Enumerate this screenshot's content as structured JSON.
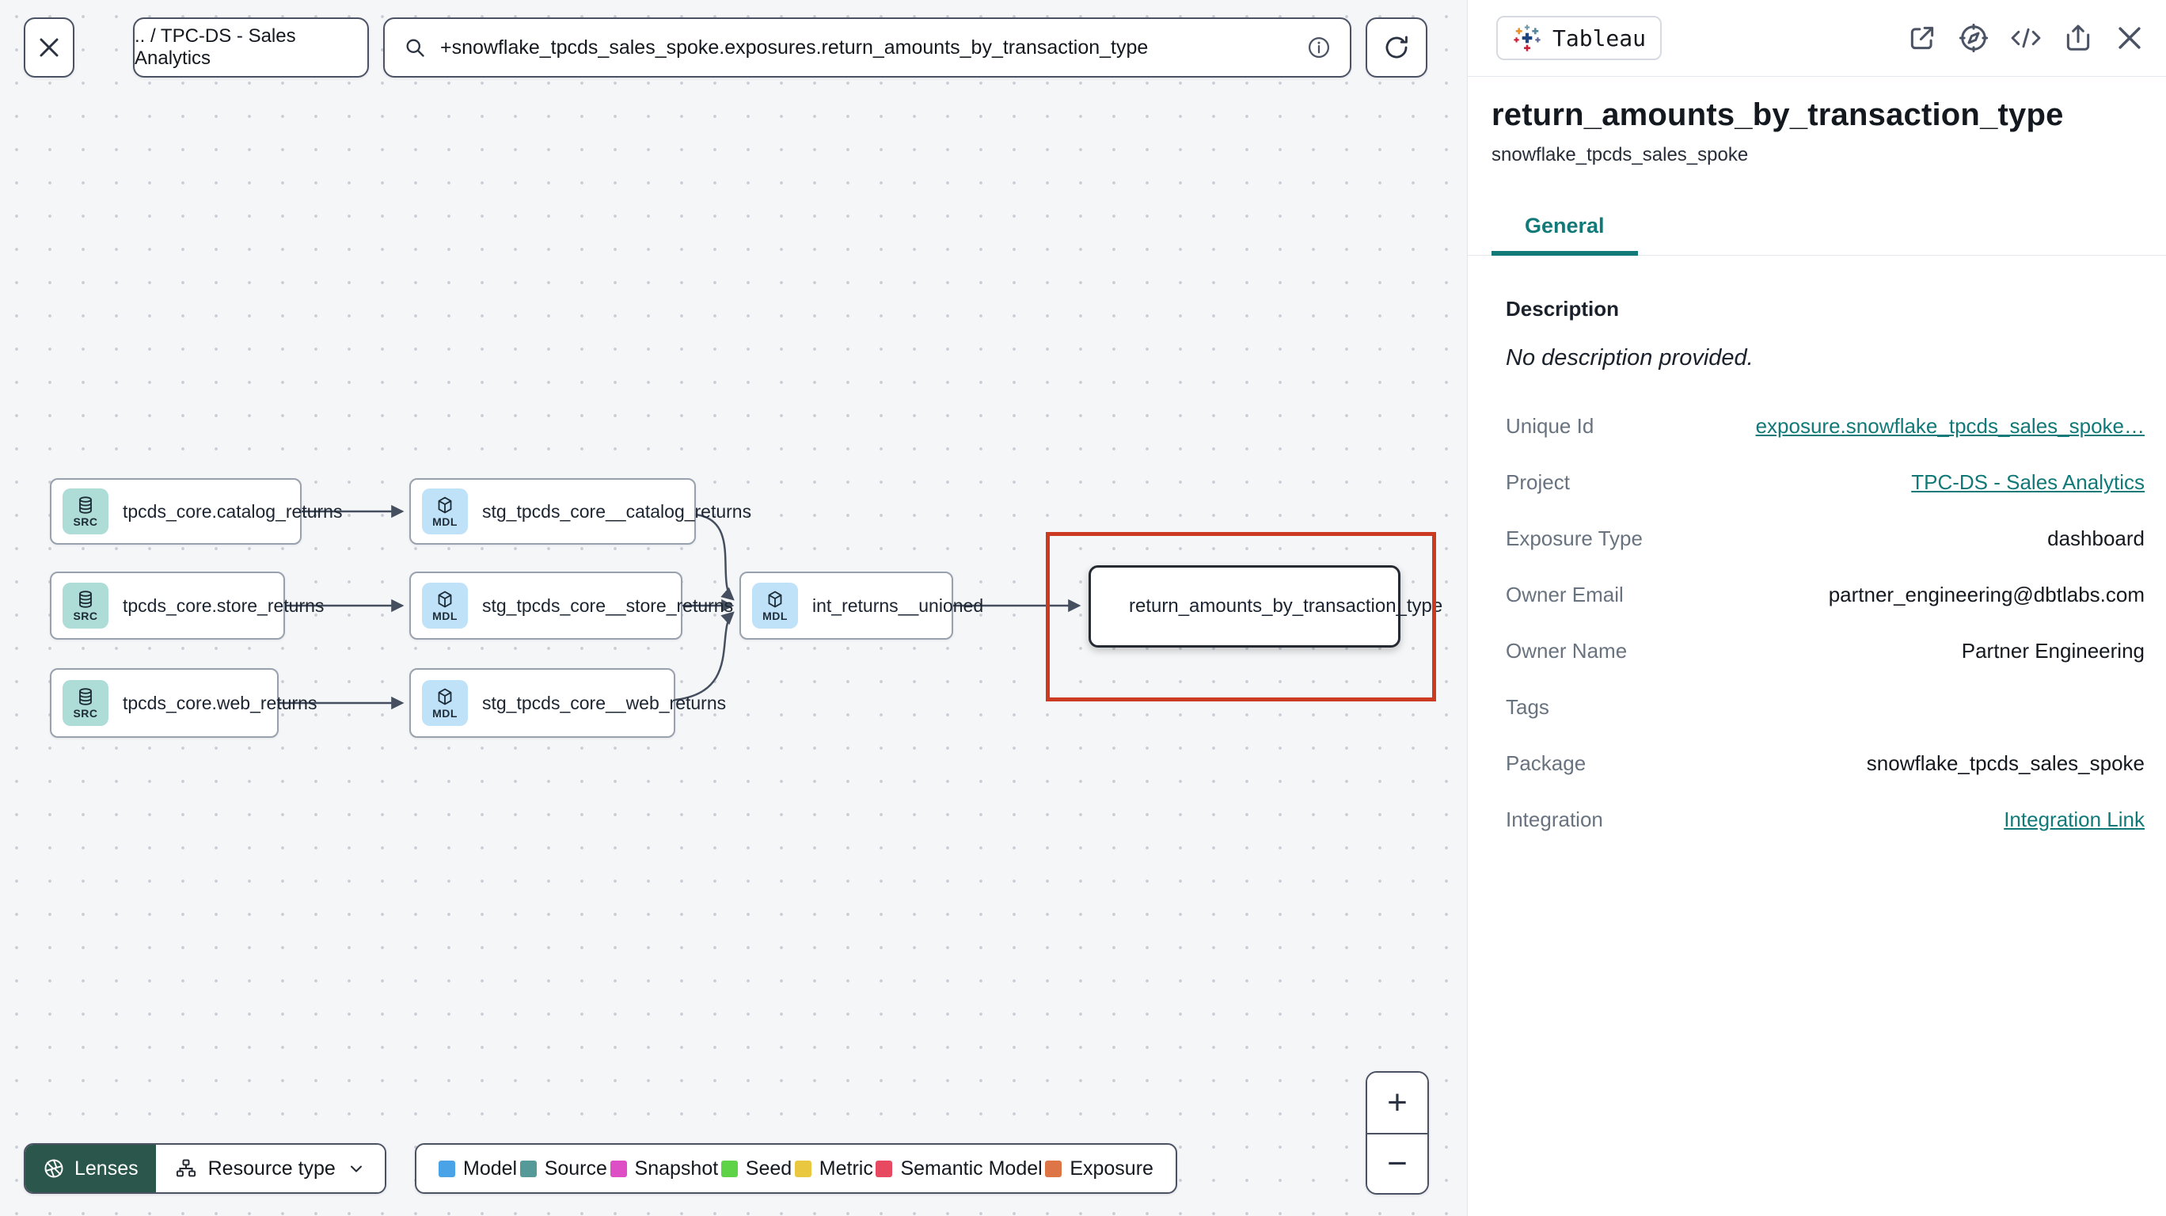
{
  "topbar": {
    "breadcrumb": ".. / TPC-DS - Sales Analytics",
    "search_value": "+snowflake_tpcds_sales_spoke.exposures.return_amounts_by_transaction_type"
  },
  "panel": {
    "integration_badge": "Tableau",
    "title": "return_amounts_by_transaction_type",
    "subtitle": "snowflake_tpcds_sales_spoke",
    "active_tab": "General",
    "description_heading": "Description",
    "description_empty": "No description provided.",
    "fields": [
      {
        "label": "Unique Id",
        "value": "exposure.snowflake_tpcds_sales_spoke…"
      },
      {
        "label": "Project",
        "value": "TPC-DS - Sales Analytics"
      },
      {
        "label": "Exposure Type",
        "value": "dashboard"
      },
      {
        "label": "Owner Email",
        "value": "partner_engineering@dbtlabs.com"
      },
      {
        "label": "Owner Name",
        "value": "Partner Engineering"
      },
      {
        "label": "Tags",
        "value": ""
      },
      {
        "label": "Package",
        "value": "snowflake_tpcds_sales_spoke"
      },
      {
        "label": "Integration",
        "value": "Integration Link"
      }
    ]
  },
  "graph": {
    "nodes": [
      {
        "id": "src_catalog_returns",
        "badge": "SRC",
        "label": "tpcds_core.catalog_returns",
        "type": "source"
      },
      {
        "id": "src_store_returns",
        "badge": "SRC",
        "label": "tpcds_core.store_returns",
        "type": "source"
      },
      {
        "id": "src_web_returns",
        "badge": "SRC",
        "label": "tpcds_core.web_returns",
        "type": "source"
      },
      {
        "id": "stg_catalog_returns",
        "badge": "MDL",
        "label": "stg_tpcds_core__catalog_returns",
        "type": "model"
      },
      {
        "id": "stg_store_returns",
        "badge": "MDL",
        "label": "stg_tpcds_core__store_returns",
        "type": "model"
      },
      {
        "id": "stg_web_returns",
        "badge": "MDL",
        "label": "stg_tpcds_core__web_returns",
        "type": "model"
      },
      {
        "id": "int_returns_unioned",
        "badge": "MDL",
        "label": "int_returns__unioned",
        "type": "model"
      },
      {
        "id": "exposure_node",
        "label": "return_amounts_by_transaction_type",
        "type": "exposure"
      }
    ],
    "edges": [
      [
        "src_catalog_returns",
        "stg_catalog_returns"
      ],
      [
        "src_store_returns",
        "stg_store_returns"
      ],
      [
        "src_web_returns",
        "stg_web_returns"
      ],
      [
        "stg_catalog_returns",
        "int_returns_unioned"
      ],
      [
        "stg_store_returns",
        "int_returns_unioned"
      ],
      [
        "stg_web_returns",
        "int_returns_unioned"
      ],
      [
        "int_returns_unioned",
        "exposure_node"
      ]
    ]
  },
  "legend": {
    "lenses_label": "Lenses",
    "resource_type_label": "Resource type",
    "items": [
      {
        "label": "Model",
        "color": "#4aa3e6"
      },
      {
        "label": "Source",
        "color": "#559a98"
      },
      {
        "label": "Snapshot",
        "color": "#de4ec4"
      },
      {
        "label": "Seed",
        "color": "#5fd348"
      },
      {
        "label": "Metric",
        "color": "#e9c83f"
      },
      {
        "label": "Semantic Model",
        "color": "#e74960"
      },
      {
        "label": "Exposure",
        "color": "#de7547"
      }
    ]
  },
  "zoom_controls": {
    "zoom_in": "+",
    "zoom_out": "−"
  }
}
